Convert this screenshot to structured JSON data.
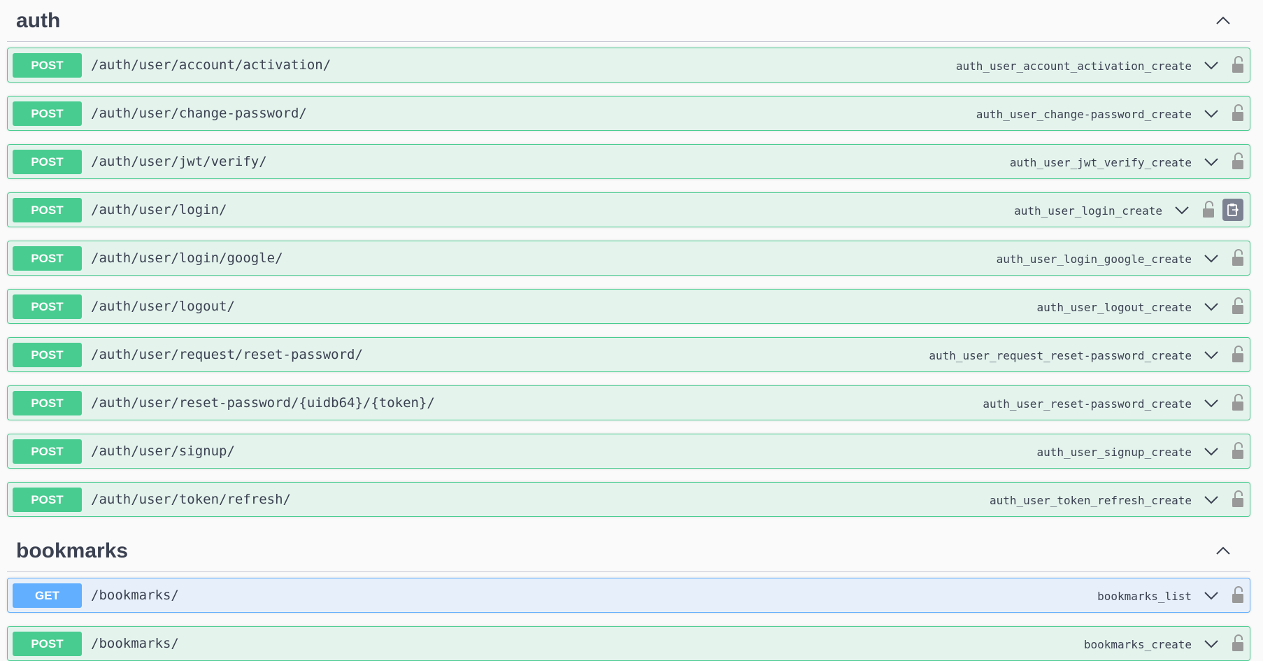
{
  "sections": [
    {
      "title": "auth",
      "operations": [
        {
          "method": "POST",
          "path": "/auth/user/account/activation/",
          "operation_id": "auth_user_account_activation_create"
        },
        {
          "method": "POST",
          "path": "/auth/user/change-password/",
          "operation_id": "auth_user_change-password_create"
        },
        {
          "method": "POST",
          "path": "/auth/user/jwt/verify/",
          "operation_id": "auth_user_jwt_verify_create"
        },
        {
          "method": "POST",
          "path": "/auth/user/login/",
          "operation_id": "auth_user_login_create"
        },
        {
          "method": "POST",
          "path": "/auth/user/login/google/",
          "operation_id": "auth_user_login_google_create"
        },
        {
          "method": "POST",
          "path": "/auth/user/logout/",
          "operation_id": "auth_user_logout_create"
        },
        {
          "method": "POST",
          "path": "/auth/user/request/reset-password/",
          "operation_id": "auth_user_request_reset-password_create"
        },
        {
          "method": "POST",
          "path": "/auth/user/reset-password/{uidb64}/{token}/",
          "operation_id": "auth_user_reset-password_create"
        },
        {
          "method": "POST",
          "path": "/auth/user/signup/",
          "operation_id": "auth_user_signup_create"
        },
        {
          "method": "POST",
          "path": "/auth/user/token/refresh/",
          "operation_id": "auth_user_token_refresh_create"
        }
      ]
    },
    {
      "title": "bookmarks",
      "operations": [
        {
          "method": "GET",
          "path": "/bookmarks/",
          "operation_id": "bookmarks_list"
        },
        {
          "method": "POST",
          "path": "/bookmarks/",
          "operation_id": "bookmarks_create"
        }
      ]
    }
  ],
  "icons": {
    "section_toggle": "chevron-up-icon",
    "expand": "chevron-down-icon",
    "auth": "unlocked-padlock-icon",
    "copy": "copy-to-clipboard-icon"
  },
  "colors": {
    "post": "#49cc90",
    "get": "#61affe"
  }
}
